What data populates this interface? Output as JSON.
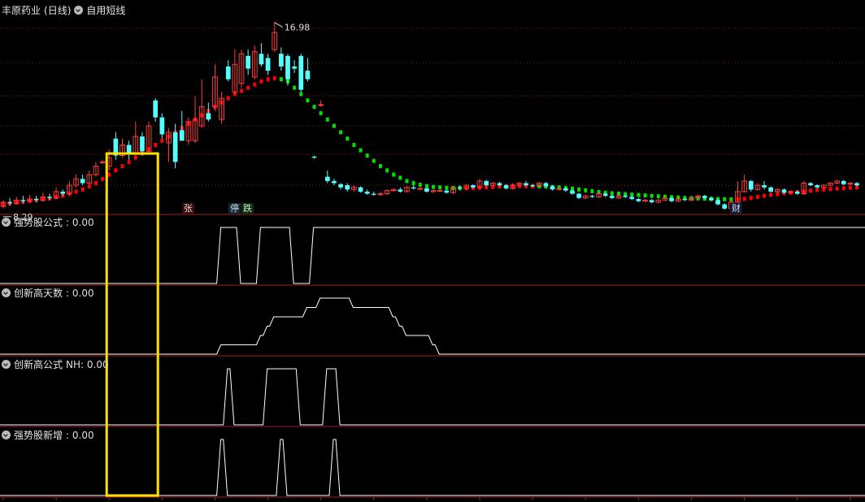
{
  "header": {
    "stock_name": "丰原药业",
    "period": "(日线)",
    "formula_name": "自用短线"
  },
  "price_labels": {
    "high_label": "16.98",
    "low_label": "8.29"
  },
  "event_badges": [
    {
      "text": "张",
      "color": "#e04040"
    },
    {
      "text": "停",
      "color": "#55d0e0"
    },
    {
      "text": "跌",
      "color": "#2ec02e"
    },
    {
      "text": "财",
      "color": "#5aa0ff"
    }
  ],
  "panels": [
    {
      "title": "强势股公式",
      "value": ": 0.00"
    },
    {
      "title": "创新高天数",
      "value": ": 0.00"
    },
    {
      "title": "创新高公式",
      "value": "NH: 0.00"
    },
    {
      "title": "强势股新增",
      "value": ": 0.00"
    }
  ],
  "colors": {
    "up": "#ff3c3c",
    "down": "#54ffff",
    "ma_up": "#ff0000",
    "ma_down": "#00e000",
    "grid": "#8a1a1a",
    "highlight": "#ffe000",
    "indicator": "#ffffff"
  },
  "chart_data": {
    "type": "candlestick",
    "y_range": [
      8.0,
      17.5
    ],
    "highlight_range": [
      16,
      23
    ],
    "candles": [
      [
        8.3,
        8.5,
        8.6,
        8.2
      ],
      [
        8.5,
        8.45,
        8.7,
        8.35
      ],
      [
        8.45,
        8.6,
        8.75,
        8.4
      ],
      [
        8.6,
        8.55,
        8.8,
        8.45
      ],
      [
        8.55,
        8.65,
        8.85,
        8.5
      ],
      [
        8.65,
        8.6,
        8.8,
        8.5
      ],
      [
        8.6,
        8.75,
        8.95,
        8.55
      ],
      [
        8.75,
        8.7,
        8.9,
        8.6
      ],
      [
        8.7,
        9.0,
        9.2,
        8.65
      ],
      [
        9.0,
        8.9,
        9.1,
        8.8
      ],
      [
        8.9,
        9.3,
        9.5,
        8.85
      ],
      [
        9.3,
        9.6,
        9.8,
        9.2
      ],
      [
        9.6,
        9.4,
        9.8,
        9.3
      ],
      [
        9.4,
        9.8,
        10.0,
        9.35
      ],
      [
        9.8,
        10.2,
        10.4,
        9.7
      ],
      [
        10.4,
        10.4,
        10.5,
        10.3
      ],
      [
        10.2,
        10.6,
        11.0,
        10.0
      ],
      [
        11.5,
        10.7,
        11.8,
        10.5
      ],
      [
        10.7,
        11.2,
        11.5,
        10.6
      ],
      [
        11.2,
        10.8,
        11.4,
        10.5
      ],
      [
        10.8,
        11.6,
        12.3,
        10.7
      ],
      [
        11.6,
        10.9,
        11.8,
        10.7
      ],
      [
        10.9,
        12.1,
        12.3,
        10.8
      ],
      [
        13.3,
        12.5,
        13.4,
        12.3
      ],
      [
        12.5,
        11.7,
        12.7,
        11.5
      ],
      [
        11.3,
        11.8,
        12.0,
        10.4
      ],
      [
        11.8,
        10.4,
        12.2,
        10.1
      ],
      [
        11.9,
        11.4,
        12.8,
        11.4
      ],
      [
        11.4,
        12.3,
        12.5,
        11.2
      ],
      [
        11.4,
        12.4,
        13.5,
        11.3
      ],
      [
        12.1,
        13.0,
        14.3,
        12.0
      ],
      [
        12.7,
        12.4,
        13.2,
        12.3
      ],
      [
        13.0,
        14.4,
        15.0,
        12.8
      ],
      [
        12.4,
        13.4,
        13.7,
        12.2
      ],
      [
        14.9,
        14.3,
        15.2,
        14.2
      ],
      [
        13.7,
        15.0,
        15.7,
        13.6
      ],
      [
        14.1,
        15.5,
        15.7,
        13.9
      ],
      [
        15.4,
        14.8,
        15.7,
        14.5
      ],
      [
        14.4,
        15.6,
        15.9,
        14.3
      ],
      [
        15.5,
        15.0,
        16.0,
        14.9
      ],
      [
        15.3,
        14.7,
        15.5,
        14.5
      ],
      [
        15.7,
        16.5,
        16.98,
        15.6
      ],
      [
        15.5,
        14.9,
        15.8,
        14.7
      ],
      [
        15.4,
        14.3,
        15.5,
        14.0
      ],
      [
        14.9,
        14.8,
        15.2,
        14.6
      ],
      [
        15.4,
        13.8,
        15.5,
        13.7
      ],
      [
        14.7,
        14.3,
        15.3,
        14.2
      ],
      [
        10.65,
        10.6,
        10.7,
        10.55
      ],
      [
        13.1,
        13.1,
        13.3,
        13.0
      ],
      [
        9.7,
        9.5,
        10.0,
        9.4
      ],
      [
        9.5,
        9.4,
        9.6,
        9.3
      ],
      [
        9.35,
        9.2,
        9.4,
        9.1
      ],
      [
        9.3,
        9.1,
        9.4,
        9.0
      ],
      [
        9.1,
        9.2,
        9.3,
        9.0
      ],
      [
        9.2,
        9.0,
        9.25,
        8.95
      ],
      [
        9.0,
        8.9,
        9.1,
        8.85
      ],
      [
        8.9,
        8.85,
        9.0,
        8.8
      ],
      [
        8.85,
        8.9,
        9.0,
        8.8
      ],
      [
        8.9,
        9.05,
        9.1,
        8.85
      ],
      [
        9.05,
        9.1,
        9.15,
        9.0
      ],
      [
        9.1,
        9.0,
        9.2,
        8.95
      ],
      [
        9.0,
        9.2,
        9.25,
        8.95
      ],
      [
        9.2,
        9.15,
        9.3,
        9.1
      ],
      [
        9.15,
        9.15,
        9.2,
        9.05
      ],
      [
        9.15,
        9.0,
        9.2,
        8.95
      ],
      [
        9.0,
        9.05,
        9.1,
        8.95
      ],
      [
        9.05,
        9.05,
        9.1,
        9.0
      ],
      [
        9.05,
        8.95,
        9.1,
        8.9
      ],
      [
        8.95,
        9.2,
        9.25,
        8.9
      ],
      [
        9.2,
        9.15,
        9.3,
        9.1
      ],
      [
        9.15,
        9.3,
        9.35,
        9.1
      ],
      [
        9.3,
        9.2,
        9.35,
        9.15
      ],
      [
        9.2,
        9.5,
        9.6,
        9.15
      ],
      [
        9.5,
        9.3,
        9.55,
        9.25
      ],
      [
        9.3,
        9.4,
        9.45,
        9.25
      ],
      [
        9.4,
        9.3,
        9.45,
        9.25
      ],
      [
        9.3,
        9.15,
        9.35,
        9.1
      ],
      [
        9.15,
        9.3,
        9.4,
        9.1
      ],
      [
        9.3,
        9.4,
        9.45,
        9.25
      ],
      [
        9.4,
        9.3,
        9.5,
        9.25
      ],
      [
        9.3,
        9.25,
        9.35,
        9.2
      ],
      [
        9.25,
        9.4,
        9.45,
        9.2
      ],
      [
        9.4,
        9.25,
        9.45,
        9.2
      ],
      [
        9.25,
        9.1,
        9.3,
        9.05
      ],
      [
        9.1,
        9.15,
        9.2,
        9.05
      ],
      [
        9.15,
        9.05,
        9.2,
        9.0
      ],
      [
        9.05,
        8.9,
        9.1,
        8.85
      ],
      [
        8.9,
        8.7,
        8.95,
        8.65
      ],
      [
        8.7,
        8.8,
        8.85,
        8.65
      ],
      [
        8.8,
        8.75,
        8.85,
        8.7
      ],
      [
        8.75,
        8.9,
        8.95,
        8.7
      ],
      [
        8.9,
        8.8,
        8.95,
        8.75
      ],
      [
        8.8,
        8.7,
        8.85,
        8.65
      ],
      [
        8.7,
        8.8,
        8.85,
        8.65
      ],
      [
        8.8,
        8.75,
        8.85,
        8.7
      ],
      [
        8.75,
        8.65,
        8.8,
        8.6
      ],
      [
        8.65,
        8.55,
        8.7,
        8.5
      ],
      [
        8.55,
        8.6,
        8.65,
        8.5
      ],
      [
        8.6,
        8.5,
        8.65,
        8.45
      ],
      [
        8.5,
        8.6,
        8.65,
        8.45
      ],
      [
        8.6,
        8.7,
        8.75,
        8.55
      ],
      [
        8.7,
        8.55,
        8.75,
        8.5
      ],
      [
        8.55,
        8.65,
        8.7,
        8.5
      ],
      [
        8.65,
        8.6,
        8.7,
        8.55
      ],
      [
        8.6,
        8.7,
        8.75,
        8.55
      ],
      [
        8.7,
        8.8,
        8.85,
        8.65
      ],
      [
        8.8,
        8.7,
        8.85,
        8.65
      ],
      [
        8.7,
        8.6,
        8.75,
        8.55
      ],
      [
        8.6,
        8.4,
        8.65,
        8.35
      ],
      [
        8.4,
        8.2,
        8.45,
        8.15
      ],
      [
        8.2,
        8.5,
        8.6,
        8.15
      ],
      [
        8.5,
        9.0,
        9.5,
        8.45
      ],
      [
        9.0,
        9.5,
        9.8,
        8.95
      ],
      [
        9.5,
        9.1,
        9.55,
        9.0
      ],
      [
        9.1,
        9.3,
        9.4,
        9.05
      ],
      [
        9.3,
        9.2,
        9.5,
        9.1
      ],
      [
        9.2,
        9.0,
        9.25,
        8.95
      ],
      [
        9.0,
        9.1,
        9.15,
        8.95
      ],
      [
        9.1,
        8.95,
        9.15,
        8.9
      ],
      [
        8.95,
        9.0,
        9.05,
        8.9
      ],
      [
        9.0,
        8.9,
        9.05,
        8.85
      ],
      [
        8.9,
        9.4,
        9.5,
        8.85
      ],
      [
        9.4,
        9.3,
        9.45,
        9.25
      ],
      [
        9.3,
        9.2,
        9.35,
        9.15
      ],
      [
        9.2,
        9.3,
        9.35,
        9.15
      ],
      [
        9.3,
        9.4,
        9.45,
        9.25
      ],
      [
        9.4,
        9.5,
        9.55,
        9.35
      ],
      [
        9.5,
        9.35,
        9.55,
        9.3
      ],
      [
        9.35,
        9.4,
        9.45,
        9.3
      ],
      [
        9.4,
        9.3,
        9.45,
        9.25
      ]
    ],
    "ma": [
      8.4,
      8.44,
      8.48,
      8.52,
      8.56,
      8.6,
      8.64,
      8.68,
      8.74,
      8.8,
      8.9,
      9.0,
      9.1,
      9.25,
      9.4,
      9.6,
      9.8,
      10.0,
      10.2,
      10.4,
      10.6,
      10.8,
      11.0,
      11.2,
      11.4,
      11.6,
      11.8,
      12.0,
      12.2,
      12.4,
      12.6,
      12.8,
      13.0,
      13.2,
      13.4,
      13.6,
      13.75,
      13.9,
      14.05,
      14.2,
      14.3,
      14.35,
      14.3,
      14.2,
      13.9,
      13.6,
      13.3,
      13.0,
      12.7,
      12.4,
      12.1,
      11.8,
      11.5,
      11.2,
      10.95,
      10.7,
      10.45,
      10.2,
      10.0,
      9.8,
      9.65,
      9.5,
      9.4,
      9.32,
      9.26,
      9.22,
      9.2,
      9.18,
      9.17,
      9.16,
      9.16,
      9.17,
      9.18,
      9.2,
      9.22,
      9.24,
      9.25,
      9.26,
      9.26,
      9.26,
      9.26,
      9.25,
      9.24,
      9.22,
      9.2,
      9.17,
      9.14,
      9.1,
      9.06,
      9.02,
      8.98,
      8.95,
      8.92,
      8.9,
      8.88,
      8.86,
      8.84,
      8.82,
      8.8,
      8.78,
      8.76,
      8.74,
      8.72,
      8.7,
      8.69,
      8.68,
      8.67,
      8.66,
      8.65,
      8.64,
      8.63,
      8.64,
      8.66,
      8.7,
      8.75,
      8.8,
      8.85,
      8.88,
      8.92,
      8.95,
      8.98,
      9.0,
      9.05,
      9.08,
      9.1,
      9.12,
      9.14,
      9.16,
      9.18,
      9.2
    ],
    "strong_stock": [
      0,
      0,
      0,
      0,
      0,
      0,
      0,
      0,
      0,
      0,
      0,
      0,
      0,
      0,
      0,
      0,
      0,
      0,
      0,
      1,
      1,
      1,
      0,
      0,
      0,
      1,
      1,
      1,
      1,
      1,
      0,
      0,
      0,
      1,
      1,
      1,
      1
    ],
    "new_high_days": [
      0,
      0,
      0,
      0,
      0,
      0,
      0,
      0,
      0,
      0,
      0,
      0,
      0,
      0,
      0,
      0,
      0,
      0,
      0,
      1,
      1,
      1,
      1,
      1,
      1,
      2,
      3,
      4,
      4,
      4,
      4,
      4,
      5,
      5,
      6,
      6,
      6,
      6,
      6,
      5,
      5,
      5,
      5,
      5,
      5,
      4,
      3,
      2,
      2,
      2,
      2,
      1,
      0,
      0,
      0,
      0
    ],
    "new_high_nh": [
      0,
      0,
      0,
      0,
      0,
      0,
      0,
      0,
      0,
      0,
      0,
      0,
      0,
      0,
      0,
      0,
      0,
      0,
      0,
      0,
      1,
      0,
      0,
      0,
      0,
      0,
      1,
      1,
      1,
      1,
      1,
      0,
      0,
      0,
      0,
      1,
      1,
      0
    ],
    "strong_new": [
      0,
      0,
      0,
      0,
      0,
      0,
      0,
      0,
      0,
      0,
      0,
      0,
      0,
      0,
      0,
      0,
      0,
      0,
      0,
      1,
      0,
      0,
      0,
      0,
      0,
      0,
      0,
      0,
      1,
      0,
      0,
      0,
      0,
      0,
      0,
      0,
      1,
      0
    ]
  }
}
